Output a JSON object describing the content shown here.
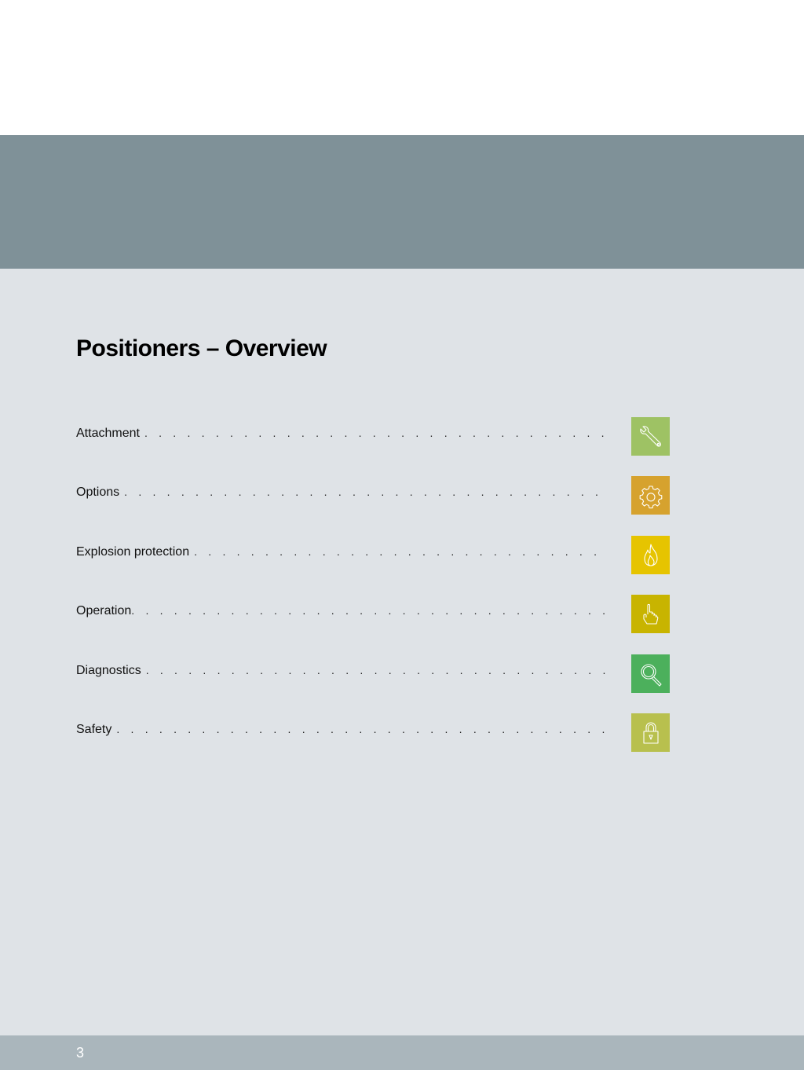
{
  "title": "Positioners – Overview",
  "toc": [
    {
      "label": "Attachment",
      "icon": "wrench-icon",
      "color": "#9ec264"
    },
    {
      "label": "Options",
      "icon": "gear-icon",
      "color": "#d6a22e"
    },
    {
      "label": "Explosion protection",
      "icon": "flame-icon",
      "color": "#e6c400"
    },
    {
      "label": "Operation",
      "icon": "pointing-hand-icon",
      "color": "#c8b400"
    },
    {
      "label": "Diagnostics",
      "icon": "magnifier-icon",
      "color": "#4cb05c"
    },
    {
      "label": "Safety",
      "icon": "padlock-icon",
      "color": "#b8c04e"
    }
  ],
  "footer": {
    "page_number": "3"
  }
}
